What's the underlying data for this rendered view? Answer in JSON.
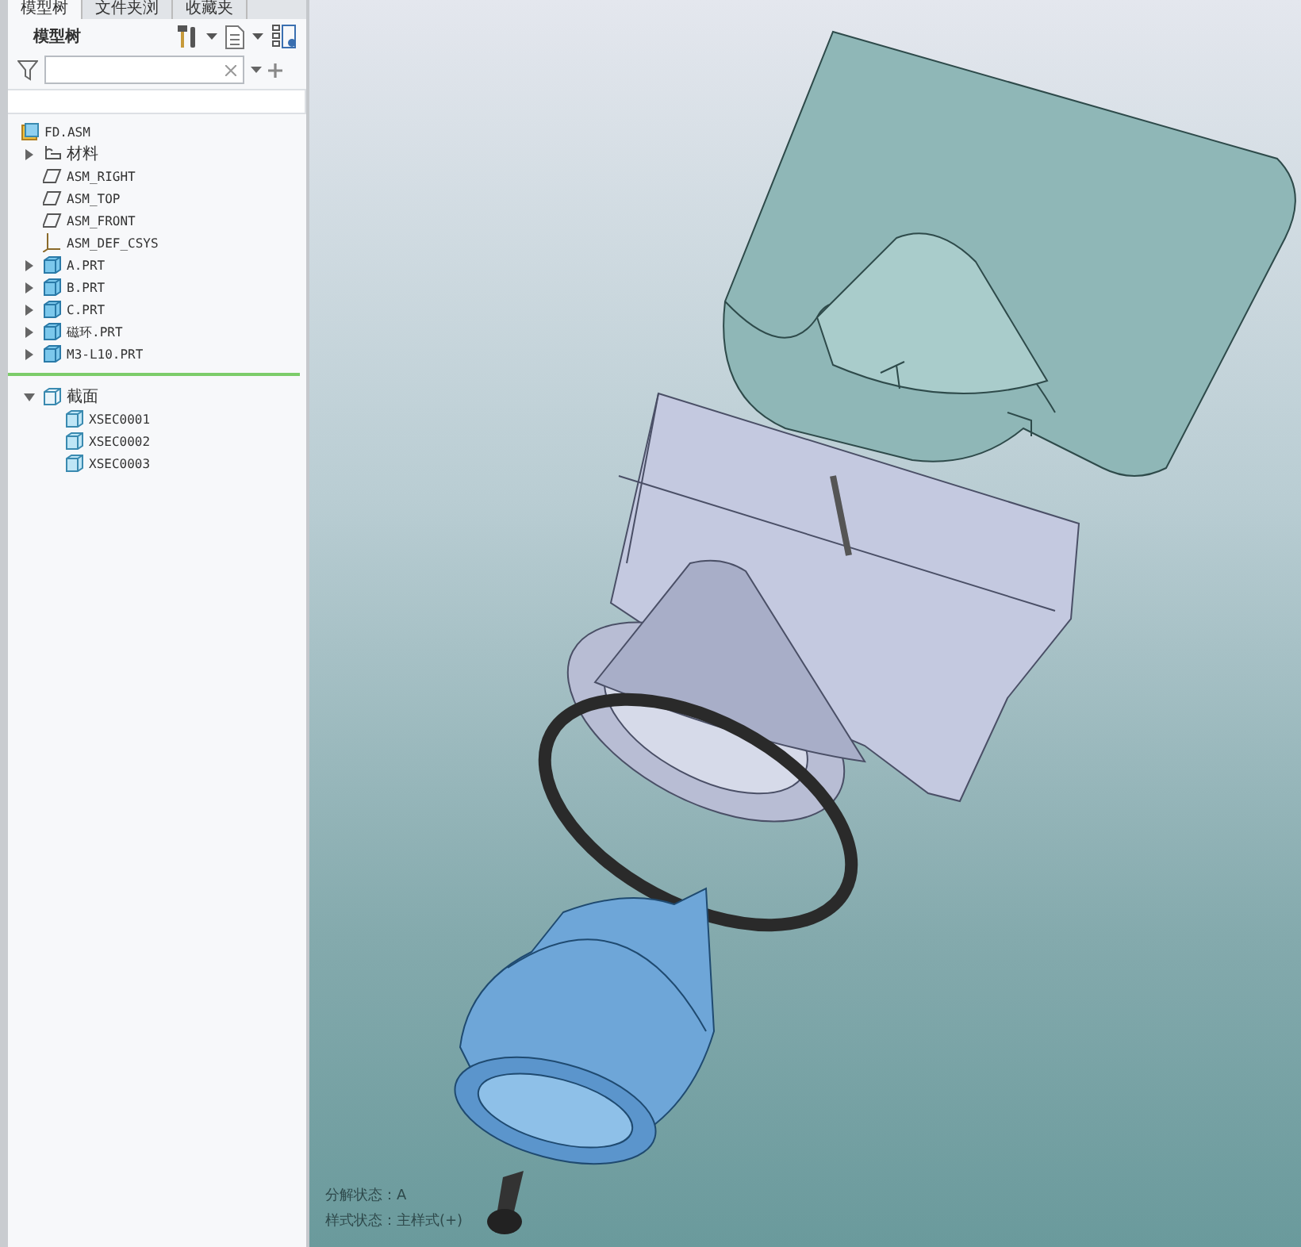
{
  "tabs": [
    {
      "label": "模型树",
      "selected": true
    },
    {
      "label": "文件夹浏",
      "selected": false
    },
    {
      "label": "收藏夹",
      "selected": false
    }
  ],
  "model_tree": {
    "title": "模型树",
    "items": [
      {
        "kind": "assembly",
        "label": "FD.ASM"
      },
      {
        "kind": "materials",
        "label": "材料",
        "expanded": false
      },
      {
        "kind": "plane",
        "label": "ASM_RIGHT"
      },
      {
        "kind": "plane",
        "label": "ASM_TOP"
      },
      {
        "kind": "plane",
        "label": "ASM_FRONT"
      },
      {
        "kind": "csys",
        "label": "ASM_DEF_CSYS"
      },
      {
        "kind": "part",
        "label": "A.PRT",
        "expanded": false
      },
      {
        "kind": "part",
        "label": "B.PRT",
        "expanded": false
      },
      {
        "kind": "part",
        "label": "C.PRT",
        "expanded": false
      },
      {
        "kind": "part",
        "label": "磁环.PRT",
        "expanded": false
      },
      {
        "kind": "part",
        "label": "M3-L10.PRT",
        "expanded": false
      }
    ],
    "sections": {
      "kind": "folder",
      "label": "截面",
      "expanded": true,
      "children": [
        {
          "kind": "section",
          "label": "XSEC0001"
        },
        {
          "kind": "section",
          "label": "XSEC0002"
        },
        {
          "kind": "section",
          "label": "XSEC0003"
        }
      ]
    }
  },
  "viewport": {
    "status_lines": [
      "分解状态：A",
      "样式状态：主样式(+)"
    ]
  }
}
